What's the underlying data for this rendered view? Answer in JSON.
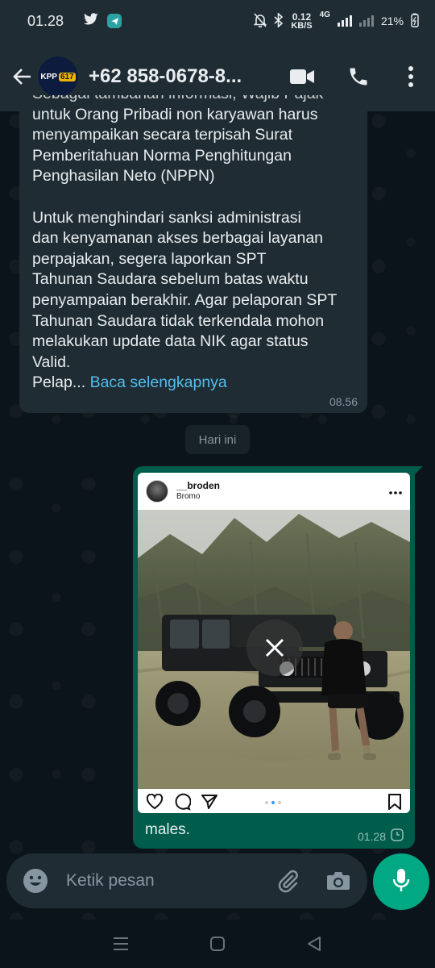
{
  "status_bar": {
    "time": "01.28",
    "net_speed_value": "0.12",
    "net_speed_unit": "KB/S",
    "network_type": "4G",
    "battery": "21%"
  },
  "header": {
    "avatar_text": "KPP",
    "avatar_badge": "617",
    "contact_name": "+62 858-0678-8..."
  },
  "incoming_message": {
    "clipped_line": "Sebagai tambahan informasi, Wajib Pajak",
    "paragraph1": "untuk Orang Pribadi non karyawan harus\nmenyampaikan secara terpisah Surat\nPemberitahuan Norma Penghitungan\nPenghasilan Neto (NPPN)",
    "paragraph2": "Untuk menghindari sanksi administrasi\ndan kenyamanan akses berbagai layanan\nperpajakan, segera laporkan SPT\nTahunan Saudara sebelum batas waktu\npenyampaian berakhir. Agar pelaporan SPT\nTahunan Saudara tidak terkendala mohon\nmelakukan update data NIK agar status\nValid.",
    "truncated": "Pelap...",
    "read_more": "Baca selengkapnya",
    "time": "08.56"
  },
  "date_chip": "Hari ini",
  "outgoing_message": {
    "ig_username": "__broden",
    "ig_location": "Bromo",
    "caption": "males.",
    "time": "01.28"
  },
  "input": {
    "placeholder": "Ketik pesan"
  },
  "icons": {
    "status": [
      "twitter-icon",
      "telegram-icon",
      "mute-icon",
      "bluetooth-icon",
      "signal-icon",
      "battery-icon"
    ],
    "header": [
      "back-arrow-icon",
      "video-call-icon",
      "phone-icon",
      "more-vertical-icon"
    ],
    "ig": [
      "heart-icon",
      "comment-icon",
      "share-icon",
      "bookmark-icon",
      "more-horizontal-icon"
    ],
    "input": [
      "emoji-icon",
      "attach-icon",
      "camera-icon",
      "mic-icon"
    ],
    "nav": [
      "menu-icon",
      "home-icon",
      "back-icon"
    ]
  },
  "colors": {
    "header_bg": "#1f2c34",
    "chat_bg": "#0b141a",
    "outgoing_bubble": "#005c4b",
    "accent": "#00a884",
    "link": "#53bdeb"
  }
}
